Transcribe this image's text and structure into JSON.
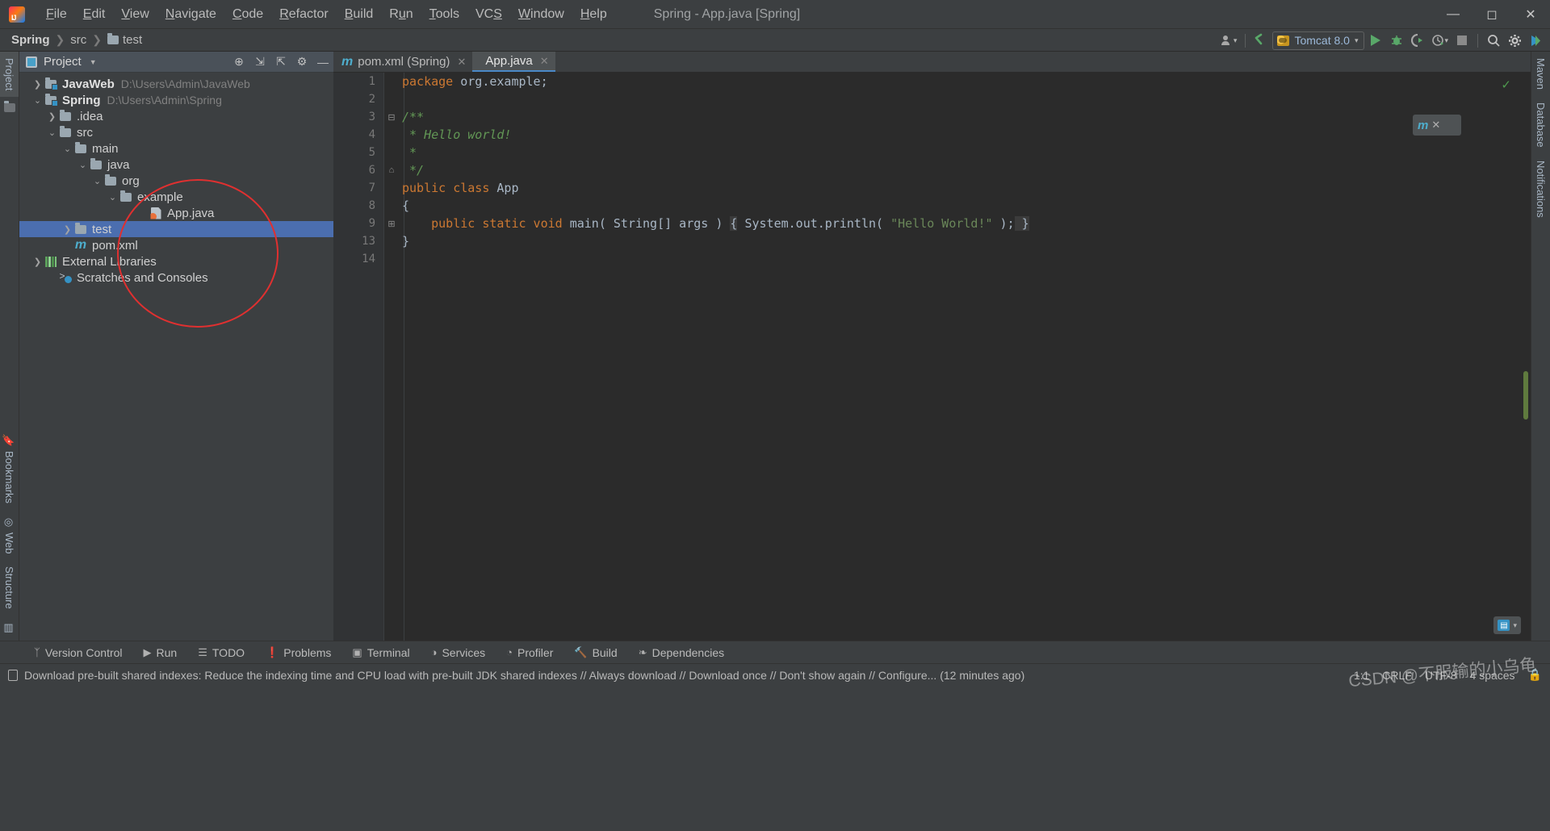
{
  "window": {
    "title": "Spring - App.java [Spring]",
    "minimize": "—",
    "maximize": "◻",
    "close": "✕"
  },
  "menu": {
    "items": [
      {
        "label": "File"
      },
      {
        "label": "Edit"
      },
      {
        "label": "View"
      },
      {
        "label": "Navigate"
      },
      {
        "label": "Code"
      },
      {
        "label": "Refactor"
      },
      {
        "label": "Build"
      },
      {
        "label": "Run"
      },
      {
        "label": "Tools"
      },
      {
        "label": "VCS"
      },
      {
        "label": "Window"
      },
      {
        "label": "Help"
      }
    ]
  },
  "breadcrumb": {
    "project": "Spring",
    "sep": "❯",
    "src": "src",
    "test": "test"
  },
  "toolbar": {
    "account_icon": "user-icon",
    "update_icon": "update-arrow-icon",
    "run_config": "Tomcat 8.0",
    "run_label": "run-button",
    "debug_label": "debug-button",
    "coverage_label": "run-with-coverage-button",
    "profile_label": "profiler-button",
    "stop_label": "stop-button",
    "search_label": "search-everywhere-button",
    "settings_label": "settings-button",
    "plugin_label": "plugin-button"
  },
  "left_strip": {
    "project": "Project",
    "bookmarks": "Bookmarks",
    "web": "Web",
    "structure": "Structure"
  },
  "right_strip": {
    "maven": "Maven",
    "database": "Database",
    "notifications": "Notifications"
  },
  "project_panel": {
    "title": "Project",
    "dropdown_caret": "▼",
    "actions": [
      "locate-icon",
      "expand-icon",
      "collapse-icon",
      "gear-icon",
      "hide-icon"
    ],
    "tree": [
      {
        "arrow": "❯",
        "icon": "module-folder",
        "name": "JavaWeb",
        "bold": true,
        "path": "D:\\Users\\Admin\\JavaWeb",
        "indent": 14,
        "selected": false
      },
      {
        "arrow": "⌄",
        "icon": "module-folder",
        "name": "Spring",
        "bold": true,
        "path": "D:\\Users\\Admin\\Spring",
        "indent": 14,
        "selected": false
      },
      {
        "arrow": "❯",
        "icon": "folder",
        "name": ".idea",
        "bold": false,
        "path": "",
        "indent": 32,
        "selected": false
      },
      {
        "arrow": "⌄",
        "icon": "folder",
        "name": "src",
        "bold": false,
        "path": "",
        "indent": 32,
        "selected": false
      },
      {
        "arrow": "⌄",
        "icon": "folder",
        "name": "main",
        "bold": false,
        "path": "",
        "indent": 51,
        "selected": false
      },
      {
        "arrow": "⌄",
        "icon": "folder",
        "name": "java",
        "bold": false,
        "path": "",
        "indent": 70,
        "selected": false
      },
      {
        "arrow": "⌄",
        "icon": "folder",
        "name": "org",
        "bold": false,
        "path": "",
        "indent": 88,
        "selected": false
      },
      {
        "arrow": "⌄",
        "icon": "folder",
        "name": "example",
        "bold": false,
        "path": "",
        "indent": 107,
        "selected": false
      },
      {
        "arrow": "",
        "icon": "java-file",
        "name": "App.java",
        "bold": false,
        "path": "",
        "indent": 144,
        "selected": false
      },
      {
        "arrow": "❯",
        "icon": "folder",
        "name": "test",
        "bold": false,
        "path": "",
        "indent": 51,
        "selected": true
      },
      {
        "arrow": "",
        "icon": "maven-file",
        "name": "pom.xml",
        "bold": false,
        "path": "",
        "indent": 51,
        "selected": false
      },
      {
        "arrow": "❯",
        "icon": "library",
        "name": "External Libraries",
        "bold": false,
        "path": "",
        "indent": 14,
        "selected": false
      },
      {
        "arrow": "",
        "icon": "scratches",
        "name": "Scratches and Consoles",
        "bold": false,
        "path": "",
        "indent": 32,
        "selected": false
      }
    ]
  },
  "editor": {
    "tabs": [
      {
        "icon": "maven-file",
        "label": "pom.xml (Spring)",
        "close": "✕",
        "active": false
      },
      {
        "icon": "java-file",
        "label": "App.java",
        "close": "✕",
        "active": true
      }
    ],
    "inspection_status": "✓",
    "float_widget": {
      "icon": "maven-icon",
      "close": "✕"
    },
    "zoom_widget": {
      "icon": "editor-mode-icon",
      "caret": "▾"
    },
    "line_numbers": [
      "1",
      "2",
      "3",
      "4",
      "5",
      "6",
      "7",
      "8",
      "9",
      "13",
      "14"
    ],
    "folds": [
      "",
      "",
      "⊟",
      "",
      "",
      "⌂",
      "",
      "",
      "⊞",
      "",
      ""
    ],
    "lines": [
      {
        "no": "1",
        "tokens": [
          {
            "t": "package ",
            "c": "kw"
          },
          {
            "t": "org.example;",
            "c": "id"
          }
        ]
      },
      {
        "no": "2",
        "tokens": []
      },
      {
        "no": "3",
        "tokens": [
          {
            "t": "/**",
            "c": "cm"
          }
        ]
      },
      {
        "no": "4",
        "tokens": [
          {
            "t": " * Hello world!",
            "c": "cm"
          }
        ]
      },
      {
        "no": "5",
        "tokens": [
          {
            "t": " *",
            "c": "cm"
          }
        ]
      },
      {
        "no": "6",
        "tokens": [
          {
            "t": " */",
            "c": "cm"
          }
        ]
      },
      {
        "no": "7",
        "tokens": [
          {
            "t": "public class ",
            "c": "kw"
          },
          {
            "t": "App",
            "c": "id"
          }
        ]
      },
      {
        "no": "8",
        "tokens": [
          {
            "t": "{",
            "c": "id"
          }
        ]
      },
      {
        "no": "9",
        "tokens": [
          {
            "t": "    ",
            "c": "id"
          },
          {
            "t": "public static void ",
            "c": "kw"
          },
          {
            "t": "main( String[] args ) ",
            "c": "id"
          },
          {
            "t": "{",
            "c": "hl"
          },
          {
            "t": " System.out.println( ",
            "c": "id"
          },
          {
            "t": "\"Hello World!\"",
            "c": "st"
          },
          {
            "t": " );",
            "c": "id"
          },
          {
            "t": " }",
            "c": "hl"
          }
        ]
      },
      {
        "no": "13",
        "tokens": [
          {
            "t": "}",
            "c": "id"
          }
        ]
      },
      {
        "no": "14",
        "tokens": []
      }
    ]
  },
  "bottom_tools": [
    {
      "icon": "vcs-icon",
      "label": "Version Control"
    },
    {
      "icon": "run-icon",
      "label": "Run"
    },
    {
      "icon": "todo-icon",
      "label": "TODO"
    },
    {
      "icon": "problems-icon",
      "label": "Problems"
    },
    {
      "icon": "terminal-icon",
      "label": "Terminal"
    },
    {
      "icon": "services-icon",
      "label": "Services"
    },
    {
      "icon": "profiler-icon",
      "label": "Profiler"
    },
    {
      "icon": "build-icon",
      "label": "Build"
    },
    {
      "icon": "dependencies-icon",
      "label": "Dependencies"
    }
  ],
  "status_bar": {
    "icon": "notification-icon",
    "message": "Download pre-built shared indexes: Reduce the indexing time and CPU load with pre-built JDK shared indexes // Always download // Download once // Don't show again // Configure... (12 minutes ago)",
    "caret_position": "1:1",
    "line_separator": "CRLF",
    "encoding": "UTF-8",
    "indent": "4 spaces",
    "lock_icon": "lock-icon"
  },
  "watermark": "CSDN @不服输的小乌龟",
  "colors": {
    "accent": "#4b6eaf",
    "panel_bg": "#3c3f41",
    "editor_bg": "#2b2b2b",
    "keyword": "#cc7832",
    "comment": "#629755",
    "string": "#6a8759",
    "annotation": "#e03030"
  }
}
